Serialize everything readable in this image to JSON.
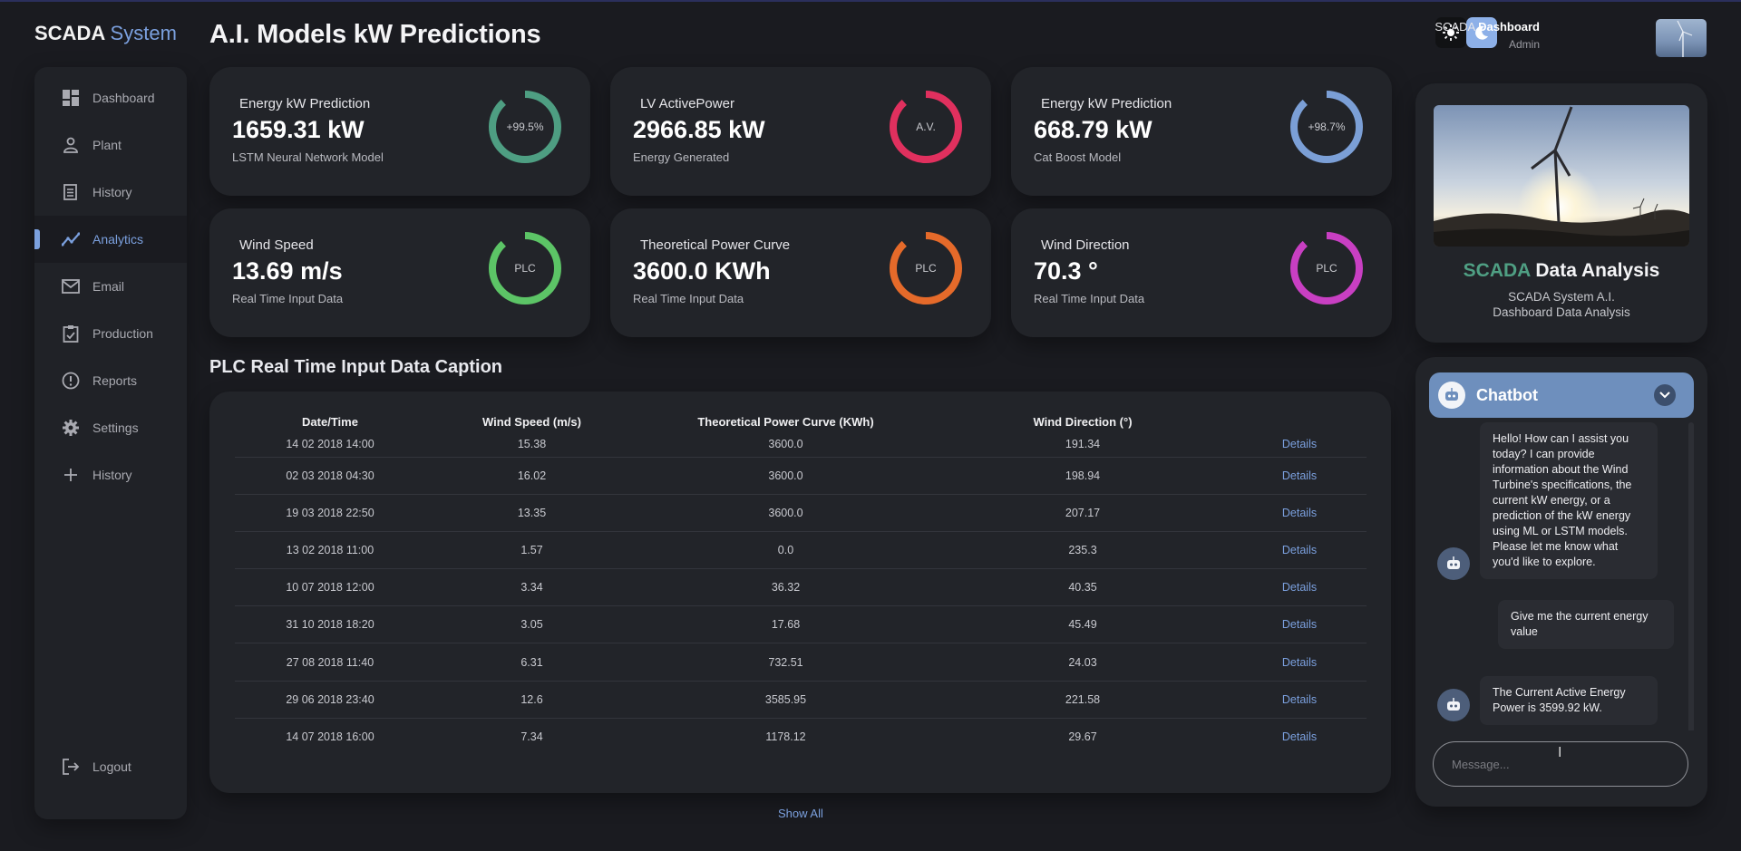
{
  "brand": {
    "name": "SCADA",
    "accent": "System"
  },
  "nav": [
    {
      "label": "Dashboard",
      "icon": "dashboard-icon",
      "active": false
    },
    {
      "label": "Plant",
      "icon": "person-icon",
      "active": false
    },
    {
      "label": "History",
      "icon": "receipt-icon",
      "active": false
    },
    {
      "label": "Analytics",
      "icon": "trending-icon",
      "active": true
    },
    {
      "label": "Email",
      "icon": "mail-icon",
      "active": false
    },
    {
      "label": "Production",
      "icon": "clipboard-icon",
      "active": false
    },
    {
      "label": "Reports",
      "icon": "alert-icon",
      "active": false
    },
    {
      "label": "Settings",
      "icon": "gear-icon",
      "active": false
    },
    {
      "label": "History",
      "icon": "plus-icon",
      "active": false
    }
  ],
  "logout": "Logout",
  "page_title": "A.I. Models kW Predictions",
  "header": {
    "user_prefix": "SCADA",
    "user_bold": "Dashboard",
    "role": "Admin"
  },
  "cards": [
    {
      "title": "Energy kW Prediction",
      "value": "1659.31 kW",
      "sub": "LSTM Neural Network Model",
      "gauge_label": "+99.5%",
      "color": "#4e9e82"
    },
    {
      "title": "LV ActivePower",
      "value": "2966.85 kW",
      "sub": "Energy Generated",
      "gauge_label": "A.V.",
      "color": "#e0305e"
    },
    {
      "title": "Energy kW Prediction",
      "value": "668.79 kW",
      "sub": "Cat Boost Model",
      "gauge_label": "+98.7%",
      "color": "#7b9fd6"
    },
    {
      "title": "Wind Speed",
      "value": "13.69 m/s",
      "sub": "Real Time Input Data",
      "gauge_label": "PLC",
      "color": "#5cc466"
    },
    {
      "title": "Theoretical Power Curve",
      "value": "3600.0 KWh",
      "sub": "Real Time Input Data",
      "gauge_label": "PLC",
      "color": "#e56a2a"
    },
    {
      "title": "Wind Direction",
      "value": "70.3 °",
      "sub": "Real Time Input Data",
      "gauge_label": "PLC",
      "color": "#c83fc2"
    }
  ],
  "table": {
    "title": "PLC Real Time Input Data Caption",
    "headers": [
      "Date/Time",
      "Wind Speed (m/s)",
      "Theoretical Power Curve (KWh)",
      "Wind Direction (°)",
      ""
    ],
    "rows": [
      [
        "14 02 2018 14:00",
        "15.38",
        "3600.0",
        "191.34",
        "Details"
      ],
      [
        "02 03 2018 04:30",
        "16.02",
        "3600.0",
        "198.94",
        "Details"
      ],
      [
        "19 03 2018 22:50",
        "13.35",
        "3600.0",
        "207.17",
        "Details"
      ],
      [
        "13 02 2018 11:00",
        "1.57",
        "0.0",
        "235.3",
        "Details"
      ],
      [
        "10 07 2018 12:00",
        "3.34",
        "36.32",
        "40.35",
        "Details"
      ],
      [
        "31 10 2018 18:20",
        "3.05",
        "17.68",
        "45.49",
        "Details"
      ],
      [
        "27 08 2018 11:40",
        "6.31",
        "732.51",
        "24.03",
        "Details"
      ],
      [
        "29 06 2018 23:40",
        "12.6",
        "3585.95",
        "221.58",
        "Details"
      ],
      [
        "14 07 2018 16:00",
        "7.34",
        "1178.12",
        "29.67",
        "Details"
      ]
    ],
    "show_all": "Show All"
  },
  "info_panel": {
    "title_accent": "SCADA",
    "title_rest": "Data Analysis",
    "sub_line1": "SCADA System A.I.",
    "sub_line2": "Dashboard Data Analysis"
  },
  "chat": {
    "title": "Chatbot",
    "messages": [
      {
        "from": "bot",
        "text": "Hello! How can I assist you today? I can provide information about the Wind Turbine's specifications, the current kW energy, or a prediction of the kW energy using ML or LSTM models. Please let me know what you'd like to explore."
      },
      {
        "from": "user",
        "text": "Give me the current energy value"
      },
      {
        "from": "bot",
        "text": "The Current Active Energy Power is 3599.92 kW."
      }
    ],
    "placeholder": "Message..."
  }
}
